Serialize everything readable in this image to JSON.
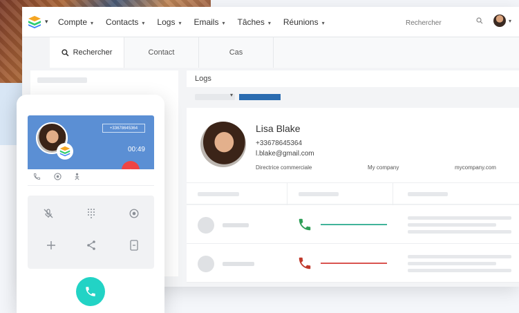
{
  "nav": {
    "menu": [
      {
        "label": "Compte"
      },
      {
        "label": "Contacts"
      },
      {
        "label": "Logs"
      },
      {
        "label": "Emails"
      },
      {
        "label": "Tâches"
      },
      {
        "label": "Réunions"
      }
    ],
    "search_placeholder": "Rechercher",
    "caret": "▾"
  },
  "tabs": [
    {
      "label": "Rechercher",
      "icon": "search-icon"
    },
    {
      "label": "Contact"
    },
    {
      "label": "Cas"
    }
  ],
  "logs": {
    "title": "Logs"
  },
  "contact": {
    "name": "Lisa Blake",
    "phone": "+33678645364",
    "email": "l.blake@gmail.com",
    "role": "Directrice commerciale",
    "company": "My company",
    "website": "mycompany.com"
  },
  "call_log": [
    {
      "status": "answered",
      "color": "#2e9e57",
      "line_color": "#41b39a"
    },
    {
      "status": "missed",
      "color": "#c0392b",
      "line_color": "#d9534f"
    }
  ],
  "phone_widget": {
    "caller_number": "+33678645364",
    "timer": "00:49",
    "banner_color": "#5b8fd4",
    "hangup_color": "#ef4444",
    "answer_color": "#22d3c5",
    "action_icons": [
      "phone-icon",
      "record-icon",
      "transfer-icon"
    ],
    "keypad_icons": [
      "mute-icon",
      "dialpad-icon",
      "record-icon",
      "add-icon",
      "share-icon",
      "hold-icon"
    ]
  },
  "colors": {
    "accent_blue": "#2b6cb0"
  }
}
